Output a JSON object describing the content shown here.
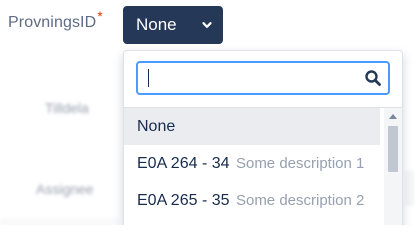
{
  "field": {
    "label": "ProvningsID",
    "required_mark": "*"
  },
  "select": {
    "value": "None",
    "icon": "chevron-down-icon"
  },
  "background_labels": {
    "label_1": "Tilldela",
    "label_2": "Assignee"
  },
  "dropdown": {
    "search": {
      "value": "",
      "placeholder": "",
      "icon": "search-icon"
    },
    "options": [
      {
        "code": "None",
        "description": ""
      },
      {
        "code": "E0A 264 - 34",
        "description": "Some description 1"
      },
      {
        "code": "E0A 265 - 35",
        "description": "Some description 2"
      }
    ],
    "selected_index": 0
  },
  "colors": {
    "button_bg": "#253858",
    "focus_border": "#4c9aff",
    "selected_option_bg": "#ebecf0",
    "required": "#de350b",
    "description_text": "#97a0af"
  }
}
